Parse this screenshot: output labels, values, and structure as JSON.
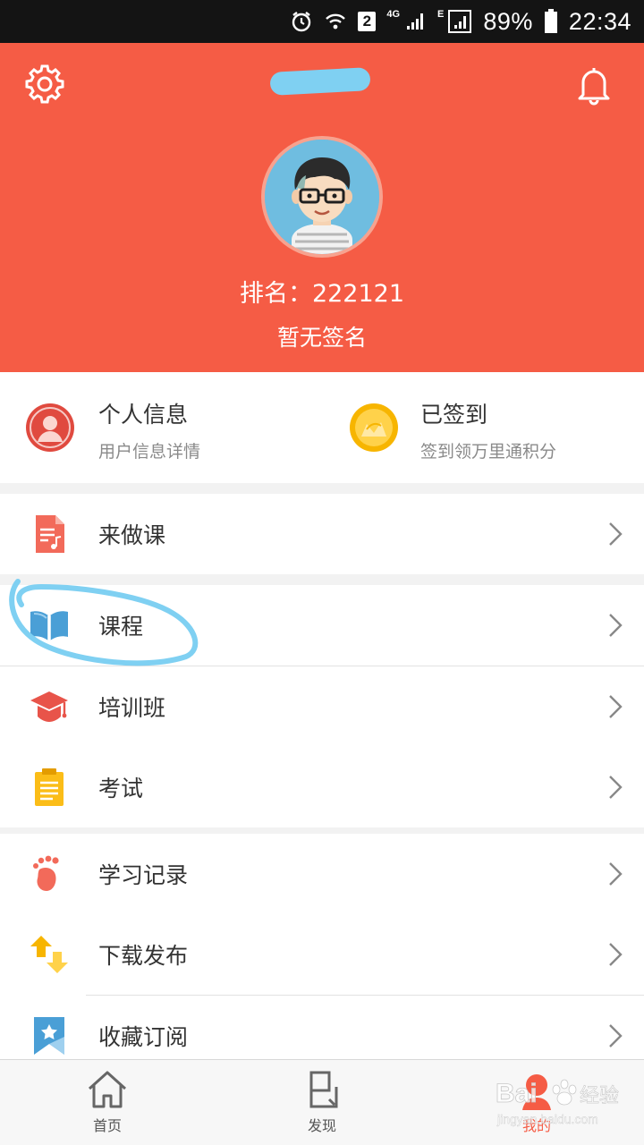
{
  "status_bar": {
    "sim_slot": "2",
    "network_4g": "4G",
    "network_e": "E",
    "battery": "89%",
    "time": "22:34"
  },
  "header": {
    "background_color": "#f55c45",
    "rank_text": "排名：222121",
    "signature_text": "暂无签名",
    "icons": {
      "left": "gear-icon",
      "right": "bell-icon"
    }
  },
  "quick_card": {
    "items": [
      {
        "title": "个人信息",
        "subtitle": "用户信息详情",
        "icon": "user-circle-icon"
      },
      {
        "title": "已签到",
        "subtitle": "签到领万里通积分",
        "icon": "checkin-coin-icon"
      }
    ]
  },
  "menu": {
    "group1": [
      {
        "label": "来做课",
        "icon": "document-music-icon"
      }
    ],
    "group2": [
      {
        "label": "课程",
        "icon": "open-book-icon"
      },
      {
        "label": "培训班",
        "icon": "graduation-cap-icon"
      },
      {
        "label": "考试",
        "icon": "clipboard-icon"
      }
    ],
    "group3": [
      {
        "label": "学习记录",
        "icon": "footprint-icon"
      },
      {
        "label": "下载发布",
        "icon": "up-down-arrows-icon"
      },
      {
        "label": "收藏订阅",
        "icon": "bookmark-star-icon"
      }
    ]
  },
  "bottom_nav": {
    "items": [
      {
        "label": "首页",
        "icon": "home-icon"
      },
      {
        "label": "发现",
        "icon": "discover-icon"
      },
      {
        "label": "我的",
        "icon": "profile-icon",
        "active": true
      }
    ]
  },
  "watermark": {
    "brand": "Baidu",
    "suffix": "经验",
    "url": "jingyan.baidu.com"
  },
  "colors": {
    "accent": "#f55c45",
    "annotation_circle": "#7fd0f2",
    "checkin_gold": "#f7b500",
    "course_blue": "#4a9fd6"
  }
}
